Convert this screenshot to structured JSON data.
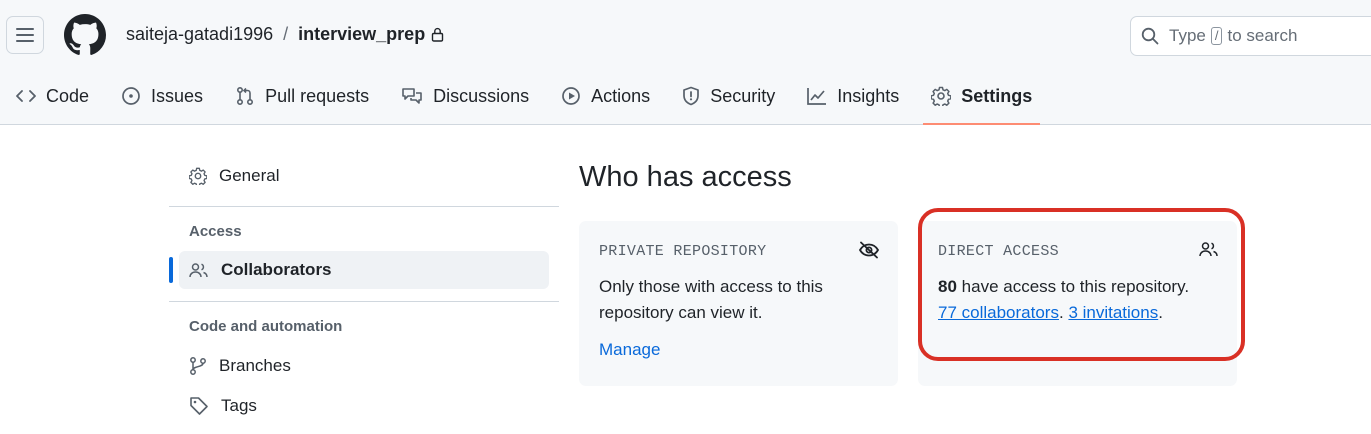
{
  "header": {
    "owner": "saiteja-gatadi1996",
    "separator": "/",
    "repo_name": "interview_prep",
    "search": {
      "type_label": "Type",
      "key": "/",
      "suffix": "to search"
    }
  },
  "tabs": [
    {
      "label": "Code",
      "icon": "code-icon"
    },
    {
      "label": "Issues",
      "icon": "issue-icon"
    },
    {
      "label": "Pull requests",
      "icon": "pull-request-icon"
    },
    {
      "label": "Discussions",
      "icon": "discussions-icon"
    },
    {
      "label": "Actions",
      "icon": "play-icon"
    },
    {
      "label": "Security",
      "icon": "shield-icon"
    },
    {
      "label": "Insights",
      "icon": "graph-icon"
    },
    {
      "label": "Settings",
      "icon": "gear-icon",
      "active": true
    }
  ],
  "sidebar": {
    "general": "General",
    "access_heading": "Access",
    "collaborators": "Collaborators",
    "automation_heading": "Code and automation",
    "branches": "Branches",
    "tags": "Tags"
  },
  "main": {
    "title": "Who has access",
    "private_card": {
      "label": "PRIVATE REPOSITORY",
      "text": "Only those with access to this repository can view it.",
      "manage": "Manage"
    },
    "direct_card": {
      "label": "DIRECT ACCESS",
      "count": "80",
      "text": "have access to this repository.",
      "collaborators_link": "77 collaborators",
      "period1": ".",
      "invitations_link": "3 invitations",
      "period2": "."
    }
  },
  "colors": {
    "accent": "#0969da",
    "active_tab_underline": "#fd8c73",
    "highlight_border": "#d93025"
  }
}
